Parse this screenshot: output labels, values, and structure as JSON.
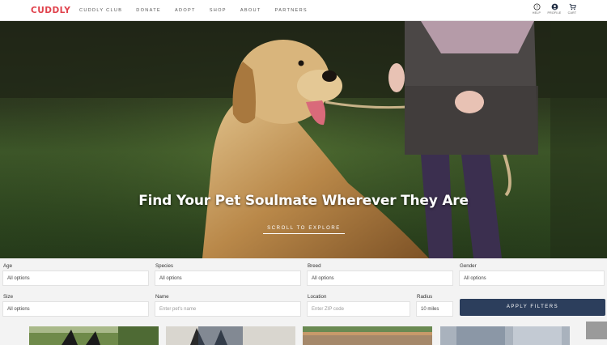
{
  "nav": {
    "logo": "CUDDLY",
    "links": [
      "CUDDLY CLUB",
      "DONATE",
      "ADOPT",
      "SHOP",
      "ABOUT",
      "PARTNERS"
    ],
    "icons": [
      {
        "icon": "help-icon",
        "label": "HELP"
      },
      {
        "icon": "profile-icon",
        "label": "PROFILE"
      },
      {
        "icon": "cart-icon",
        "label": "CART"
      }
    ]
  },
  "hero": {
    "title": "Find Your Pet Soulmate Wherever They Are",
    "cta": "SCROLL TO EXPLORE"
  },
  "filters": {
    "age": {
      "label": "Age",
      "value": "All options"
    },
    "species": {
      "label": "Species",
      "value": "All options"
    },
    "breed": {
      "label": "Breed",
      "value": "All options"
    },
    "gender": {
      "label": "Gender",
      "value": "All options"
    },
    "size": {
      "label": "Size",
      "value": "All options"
    },
    "name": {
      "label": "Name",
      "placeholder": "Enter pet's name"
    },
    "location": {
      "label": "Location",
      "placeholder": "Enter ZIP code"
    },
    "radius": {
      "label": "Radius",
      "value": "10 miles"
    },
    "apply": "APPLY FILTERS"
  },
  "colors": {
    "brand": "#e0414b",
    "button": "#2c3e5c"
  }
}
